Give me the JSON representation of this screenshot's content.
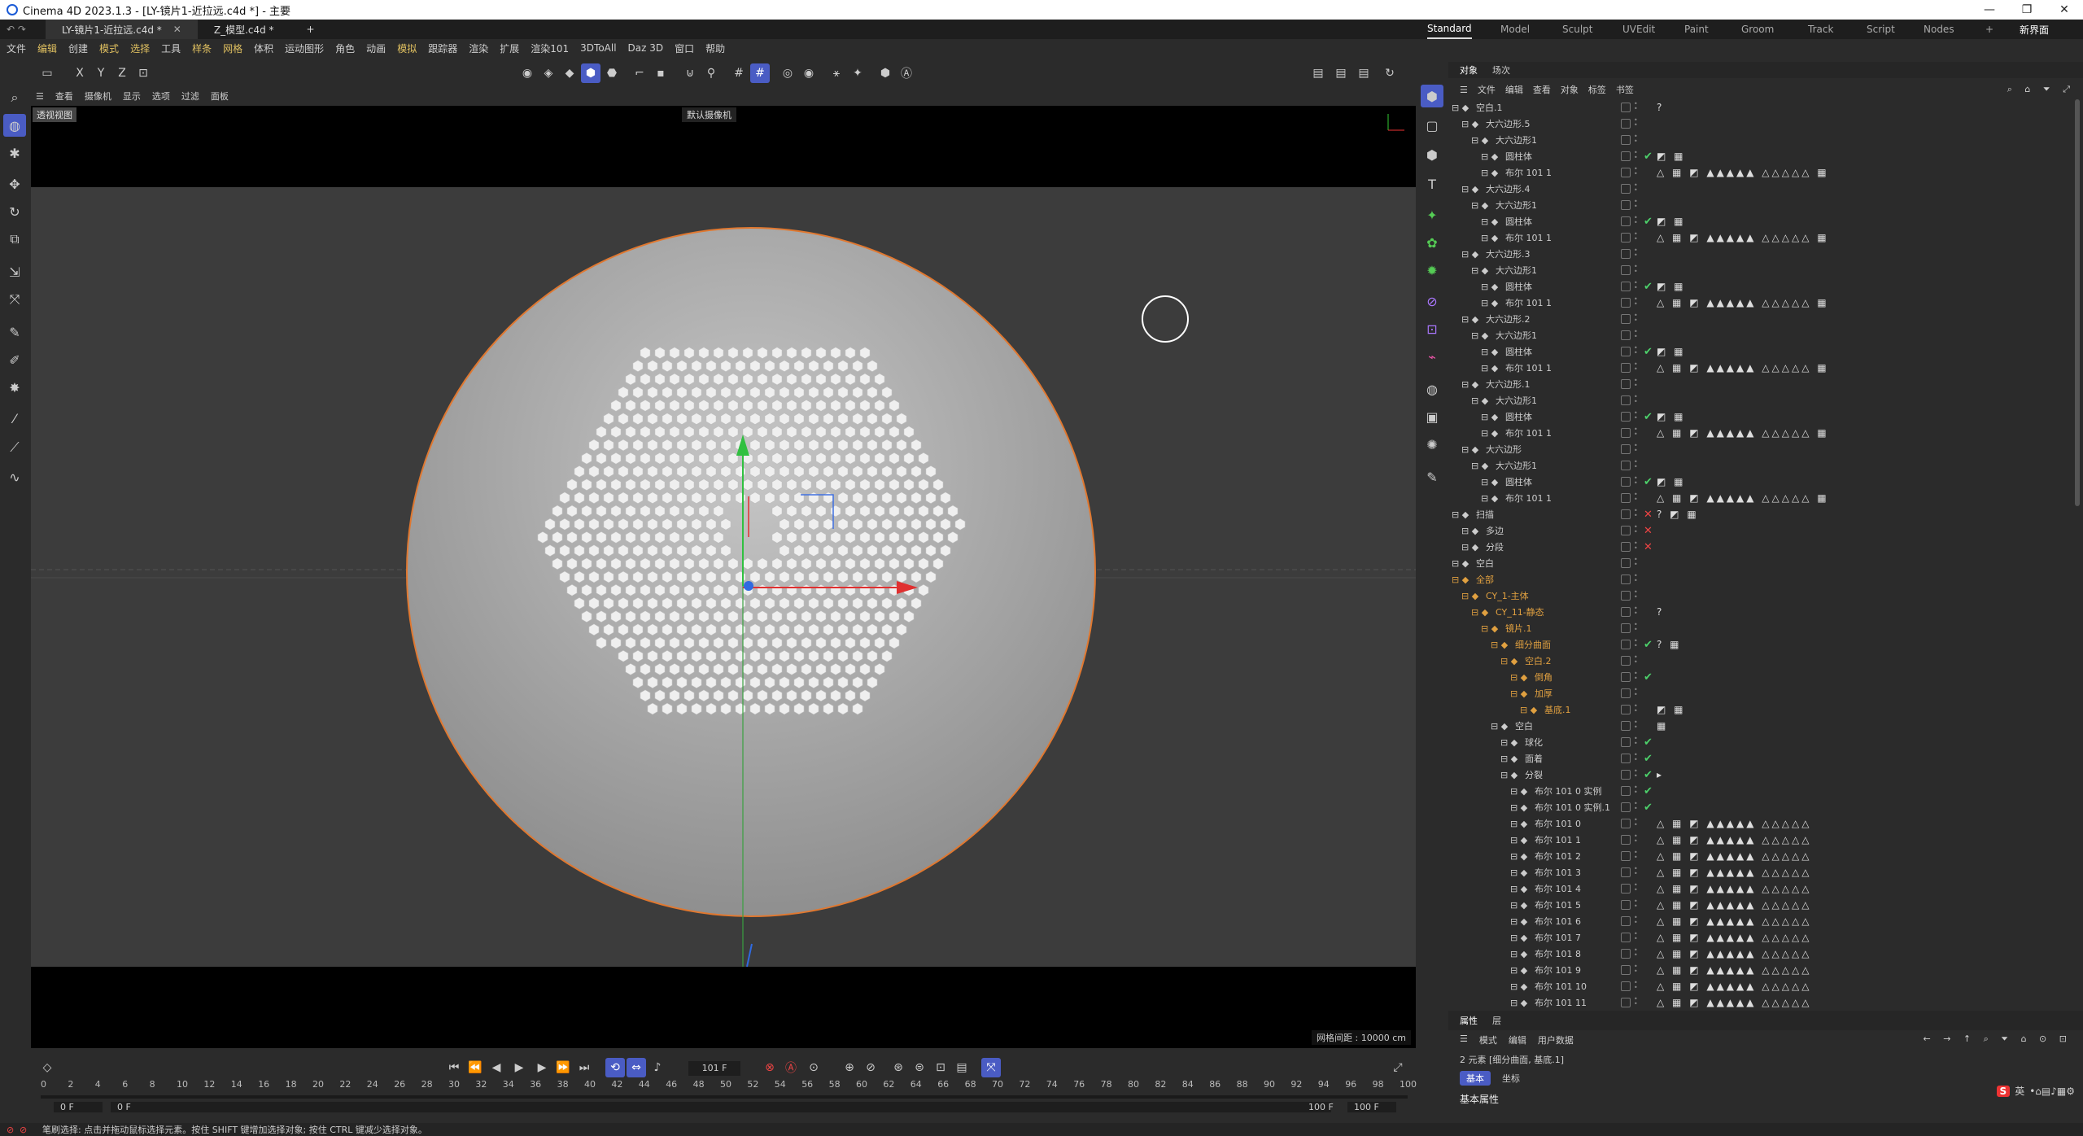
{
  "window": {
    "title": "Cinema 4D 2023.1.3 - [LY-镜片1-近拉远.c4d *] - 主要"
  },
  "doc_tabs": [
    {
      "label": "LY-镜片1-近拉远.c4d *"
    },
    {
      "label": "Z_模型.c4d *"
    }
  ],
  "layouts": [
    "Standard",
    "Model",
    "Sculpt",
    "UVEdit",
    "Paint",
    "Groom",
    "Track",
    "Script",
    "Nodes"
  ],
  "new_ui": "新界面",
  "menus": [
    "文件",
    "编辑",
    "创建",
    "模式",
    "选择",
    "工具",
    "样条",
    "网格",
    "体积",
    "运动图形",
    "角色",
    "动画",
    "模拟",
    "跟踪器",
    "渲染",
    "扩展",
    "渲染101",
    "3DToAll",
    "Daz 3D",
    "窗口",
    "帮助"
  ],
  "axis_buttons": [
    "X",
    "Y",
    "Z"
  ],
  "vp_menu": [
    "查看",
    "摄像机",
    "显示",
    "选项",
    "过滤",
    "面板"
  ],
  "viewport": {
    "label": "透视视图",
    "camera": "默认摄像机",
    "grid": "网格间距 : 10000 cm"
  },
  "timeline": {
    "frame": "101 F",
    "ticks": [
      "0",
      "2",
      "4",
      "6",
      "8",
      "10",
      "12",
      "14",
      "16",
      "18",
      "20",
      "22",
      "24",
      "26",
      "28",
      "30",
      "32",
      "34",
      "36",
      "38",
      "40",
      "42",
      "44",
      "46",
      "48",
      "50",
      "52",
      "54",
      "56",
      "58",
      "60",
      "62",
      "64",
      "66",
      "68",
      "70",
      "72",
      "74",
      "76",
      "78",
      "80",
      "82",
      "84",
      "86",
      "88",
      "90",
      "92",
      "94",
      "96",
      "98",
      "100"
    ],
    "start_a": "0 F",
    "start_b": "0 F",
    "end_a": "100 F",
    "end_b": "100 F"
  },
  "om_tabs": [
    "对象",
    "场次"
  ],
  "om_menu": [
    "文件",
    "编辑",
    "查看",
    "对象",
    "标签",
    "书签"
  ],
  "objects": [
    {
      "n": "空白.1",
      "d": 0,
      "c": "#ccc",
      "t": "?"
    },
    {
      "n": "大六边形.5",
      "d": 1,
      "c": "#ccc"
    },
    {
      "n": "大六边形1",
      "d": 2,
      "c": "#ccc"
    },
    {
      "n": "圆柱体",
      "d": 3,
      "c": "#ccc",
      "chk": true,
      "t": "◩ ▦"
    },
    {
      "n": "布尔 101 1",
      "d": 3,
      "c": "#ccc",
      "t": "△ ▦ ◩ ▲▲▲▲▲ △△△△△ ▦"
    },
    {
      "n": "大六边形.4",
      "d": 1,
      "c": "#ccc"
    },
    {
      "n": "大六边形1",
      "d": 2,
      "c": "#ccc"
    },
    {
      "n": "圆柱体",
      "d": 3,
      "c": "#ccc",
      "chk": true,
      "t": "◩ ▦"
    },
    {
      "n": "布尔 101 1",
      "d": 3,
      "c": "#ccc",
      "t": "△ ▦ ◩ ▲▲▲▲▲ △△△△△ ▦"
    },
    {
      "n": "大六边形.3",
      "d": 1,
      "c": "#ccc"
    },
    {
      "n": "大六边形1",
      "d": 2,
      "c": "#ccc"
    },
    {
      "n": "圆柱体",
      "d": 3,
      "c": "#ccc",
      "chk": true,
      "t": "◩ ▦"
    },
    {
      "n": "布尔 101 1",
      "d": 3,
      "c": "#ccc",
      "t": "△ ▦ ◩ ▲▲▲▲▲ △△△△△ ▦"
    },
    {
      "n": "大六边形.2",
      "d": 1,
      "c": "#ccc"
    },
    {
      "n": "大六边形1",
      "d": 2,
      "c": "#ccc"
    },
    {
      "n": "圆柱体",
      "d": 3,
      "c": "#ccc",
      "chk": true,
      "t": "◩ ▦"
    },
    {
      "n": "布尔 101 1",
      "d": 3,
      "c": "#ccc",
      "t": "△ ▦ ◩ ▲▲▲▲▲ △△△△△ ▦"
    },
    {
      "n": "大六边形.1",
      "d": 1,
      "c": "#ccc"
    },
    {
      "n": "大六边形1",
      "d": 2,
      "c": "#ccc"
    },
    {
      "n": "圆柱体",
      "d": 3,
      "c": "#ccc",
      "chk": true,
      "t": "◩ ▦"
    },
    {
      "n": "布尔 101 1",
      "d": 3,
      "c": "#ccc",
      "t": "△ ▦ ◩ ▲▲▲▲▲ △△△△△ ▦"
    },
    {
      "n": "大六边形",
      "d": 1,
      "c": "#ccc"
    },
    {
      "n": "大六边形1",
      "d": 2,
      "c": "#ccc"
    },
    {
      "n": "圆柱体",
      "d": 3,
      "c": "#ccc",
      "chk": true,
      "t": "◩ ▦"
    },
    {
      "n": "布尔 101 1",
      "d": 3,
      "c": "#ccc",
      "t": "△ ▦ ◩ ▲▲▲▲▲ △△△△△ ▦"
    },
    {
      "n": "扫描",
      "d": 0,
      "c": "#ccc",
      "crs": true,
      "t": "? ◩ ▦"
    },
    {
      "n": "多边",
      "d": 1,
      "c": "#ccc",
      "crs": true
    },
    {
      "n": "分段",
      "d": 1,
      "c": "#ccc",
      "crs": true
    },
    {
      "n": "空白",
      "d": 0,
      "c": "#ccc"
    },
    {
      "n": "全部",
      "d": 0,
      "c": "#e0a040"
    },
    {
      "n": "CY_1-主体",
      "d": 1,
      "c": "#e0a040"
    },
    {
      "n": "CY_11-静态",
      "d": 2,
      "c": "#e0a040",
      "t": "?"
    },
    {
      "n": "镜片.1",
      "d": 3,
      "c": "#e0a040"
    },
    {
      "n": "细分曲面",
      "d": 4,
      "c": "#e0a040",
      "chk": true,
      "t": "? ▦"
    },
    {
      "n": "空白.2",
      "d": 5,
      "c": "#e0a040"
    },
    {
      "n": "倒角",
      "d": 6,
      "c": "#e0a040",
      "chk": true
    },
    {
      "n": "加厚",
      "d": 6,
      "c": "#e0a040"
    },
    {
      "n": "基底.1",
      "d": 7,
      "c": "#e0a040",
      "t": "◩ ▦"
    },
    {
      "n": "空白",
      "d": 4,
      "c": "#ccc",
      "t": "▦"
    },
    {
      "n": "球化",
      "d": 5,
      "c": "#ccc",
      "chk": true
    },
    {
      "n": "面着",
      "d": 5,
      "c": "#ccc",
      "chk": true
    },
    {
      "n": "分裂",
      "d": 5,
      "c": "#ccc",
      "chk": true,
      "t": "▸"
    },
    {
      "n": "布尔 101 0 实例",
      "d": 6,
      "c": "#ccc",
      "chk": true
    },
    {
      "n": "布尔 101 0 实例.1",
      "d": 6,
      "c": "#ccc",
      "chk": true
    },
    {
      "n": "布尔 101 0",
      "d": 6,
      "c": "#ccc",
      "t": "△ ▦ ◩ ▲▲▲▲▲ △△△△△"
    },
    {
      "n": "布尔 101 1",
      "d": 6,
      "c": "#ccc",
      "t": "△ ▦ ◩ ▲▲▲▲▲ △△△△△"
    },
    {
      "n": "布尔 101 2",
      "d": 6,
      "c": "#ccc",
      "t": "△ ▦ ◩ ▲▲▲▲▲ △△△△△"
    },
    {
      "n": "布尔 101 3",
      "d": 6,
      "c": "#ccc",
      "t": "△ ▦ ◩ ▲▲▲▲▲ △△△△△"
    },
    {
      "n": "布尔 101 4",
      "d": 6,
      "c": "#ccc",
      "t": "△ ▦ ◩ ▲▲▲▲▲ △△△△△"
    },
    {
      "n": "布尔 101 5",
      "d": 6,
      "c": "#ccc",
      "t": "△ ▦ ◩ ▲▲▲▲▲ △△△△△"
    },
    {
      "n": "布尔 101 6",
      "d": 6,
      "c": "#ccc",
      "t": "△ ▦ ◩ ▲▲▲▲▲ △△△△△"
    },
    {
      "n": "布尔 101 7",
      "d": 6,
      "c": "#ccc",
      "t": "△ ▦ ◩ ▲▲▲▲▲ △△△△△"
    },
    {
      "n": "布尔 101 8",
      "d": 6,
      "c": "#ccc",
      "t": "△ ▦ ◩ ▲▲▲▲▲ △△△△△"
    },
    {
      "n": "布尔 101 9",
      "d": 6,
      "c": "#ccc",
      "t": "△ ▦ ◩ ▲▲▲▲▲ △△△△△"
    },
    {
      "n": "布尔 101 10",
      "d": 6,
      "c": "#ccc",
      "t": "△ ▦ ◩ ▲▲▲▲▲ △△△△△"
    },
    {
      "n": "布尔 101 11",
      "d": 6,
      "c": "#ccc",
      "t": "△ ▦ ◩ ▲▲▲▲▲ △△△△△"
    }
  ],
  "attr": {
    "tabs": [
      "属性",
      "层"
    ],
    "menu": [
      "模式",
      "编辑",
      "用户数据"
    ],
    "info": "2 元素 [细分曲面, 基底.1]",
    "sub_tabs": [
      "基本",
      "坐标"
    ],
    "section": "基本属性"
  },
  "status": "笔刷选择: 点击并拖动鼠标选择元素。按住 SHIFT 键增加选择对象; 按住 CTRL 键减少选择对象。",
  "ime": "英"
}
